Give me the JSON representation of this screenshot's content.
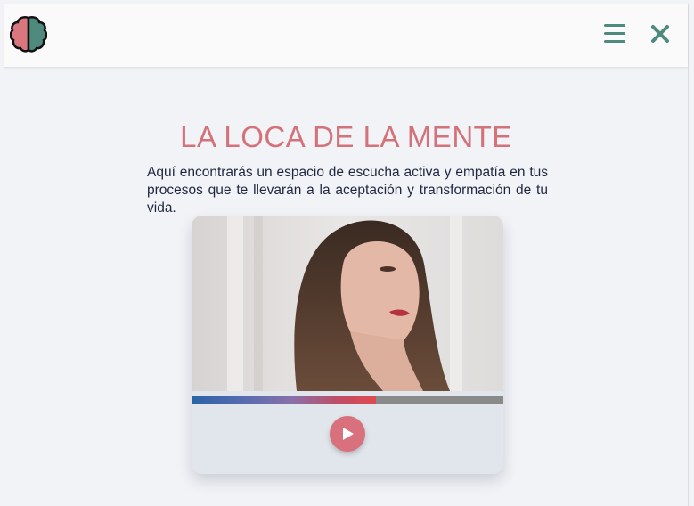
{
  "header": {
    "logo_icon": "brain-icon",
    "menu_icon": "hamburger-menu-icon",
    "close_icon": "close-icon",
    "accent_color": "#4e8a7d"
  },
  "main": {
    "title": "LA LOCA DE LA MENTE",
    "intro": "Aquí encontrarás un espacio de escucha activa y empatía en tus procesos que te llevarán a la aceptación y transformación de tu vida.",
    "title_color": "#d4727a"
  },
  "player": {
    "progress": 0.59,
    "play_icon": "play-icon",
    "play_color": "#d8717b"
  }
}
